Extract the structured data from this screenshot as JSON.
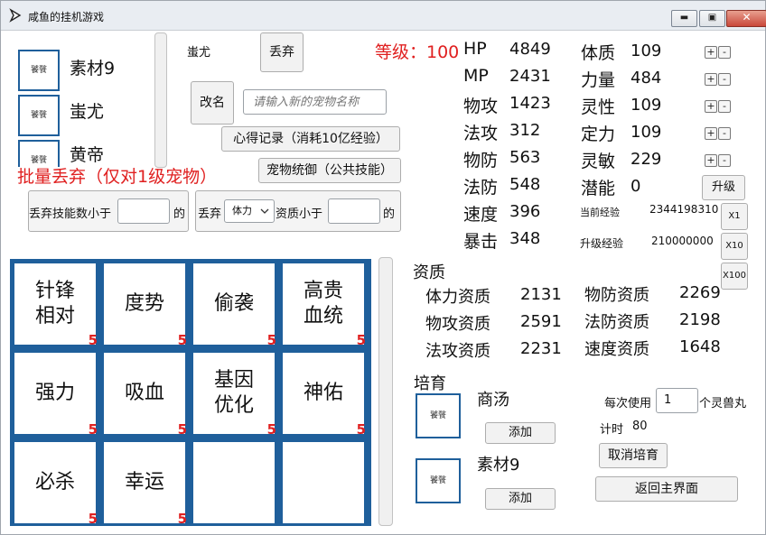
{
  "window": {
    "title": "咸鱼的挂机游戏",
    "min_label": "▬",
    "max_label": "▣",
    "close_label": "✕"
  },
  "pet_list": {
    "items": [
      {
        "icon_text": "饕餮",
        "name": "素材9"
      },
      {
        "icon_text": "饕餮",
        "name": "蚩尤"
      },
      {
        "icon_text": "饕餮",
        "name": "黄帝"
      }
    ]
  },
  "selected_pet": {
    "name": "蚩尤",
    "discard_label": "丢弃",
    "rename_label": "改名",
    "rename_placeholder": "请输入新的宠物名称"
  },
  "actions": {
    "notes_label": "心得记录（消耗10亿经验）",
    "skills_label": "宠物统御（公共技能）"
  },
  "batch": {
    "title": "批量丢弃（仅对1级宠物）",
    "skill_prefix": "丢弃技能数小于",
    "skill_suffix": "的",
    "attr_prefix": "丢弃",
    "attr_selected": "体力",
    "attr_middle": "资质小于",
    "attr_suffix": "的"
  },
  "skills": [
    {
      "name": "针锋相对",
      "level": "5"
    },
    {
      "name": "度势",
      "level": "5"
    },
    {
      "name": "偷袭",
      "level": "5"
    },
    {
      "name": "高贵血统",
      "level": "5"
    },
    {
      "name": "强力",
      "level": "5"
    },
    {
      "name": "吸血",
      "level": "5"
    },
    {
      "name": "基因优化",
      "level": "5"
    },
    {
      "name": "神佑",
      "level": "5"
    },
    {
      "name": "必杀",
      "level": "5"
    },
    {
      "name": "幸运",
      "level": "5"
    },
    {
      "name": "",
      "level": ""
    },
    {
      "name": "",
      "level": ""
    }
  ],
  "level": {
    "label": "等级：100"
  },
  "stats": {
    "hp": {
      "label": "HP",
      "value": "4849"
    },
    "mp": {
      "label": "MP",
      "value": "2431"
    },
    "patk": {
      "label": "物攻",
      "value": "1423"
    },
    "matk": {
      "label": "法攻",
      "value": "312"
    },
    "pdef": {
      "label": "物防",
      "value": "563"
    },
    "mdef": {
      "label": "法防",
      "value": "548"
    },
    "speed": {
      "label": "速度",
      "value": "396"
    },
    "crit": {
      "label": "暴击",
      "value": "348"
    }
  },
  "attrs": {
    "con": {
      "label": "体质",
      "value": "109"
    },
    "str": {
      "label": "力量",
      "value": "484"
    },
    "spi": {
      "label": "灵性",
      "value": "109"
    },
    "foc": {
      "label": "定力",
      "value": "109"
    },
    "agi": {
      "label": "灵敏",
      "value": "229"
    },
    "pot": {
      "label": "潜能",
      "value": "0"
    },
    "plus": "+",
    "minus": "-",
    "upgrade_label": "升级"
  },
  "exp": {
    "current_label": "当前经验",
    "current_value": "2344198310",
    "next_label": "升级经验",
    "next_value": "210000000",
    "x1": "X1",
    "x10": "X10",
    "x100": "X100"
  },
  "aptitude": {
    "title": "资质",
    "hp": {
      "label": "体力资质",
      "value": "2131"
    },
    "patk": {
      "label": "物攻资质",
      "value": "2591"
    },
    "matk": {
      "label": "法攻资质",
      "value": "2231"
    },
    "pdef": {
      "label": "物防资质",
      "value": "2269"
    },
    "mdef": {
      "label": "法防资质",
      "value": "2198"
    },
    "speed": {
      "label": "速度资质",
      "value": "1648"
    }
  },
  "nurture": {
    "title": "培育",
    "slot1": {
      "icon_text": "饕餮",
      "name": "商汤",
      "add_label": "添加"
    },
    "slot2": {
      "icon_text": "饕餮",
      "name": "素材9",
      "add_label": "添加"
    },
    "per_use_prefix": "每次使用",
    "per_use_value": "1",
    "per_use_suffix": "个灵兽丸",
    "timer_label": "计时",
    "timer_value": "80",
    "cancel_label": "取消培育",
    "back_label": "返回主界面"
  }
}
